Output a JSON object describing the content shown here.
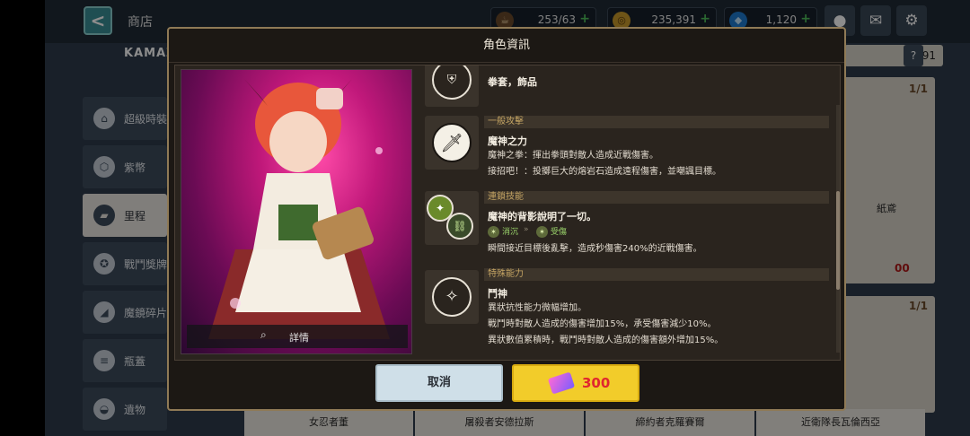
{
  "topbar": {
    "back_label": "<",
    "title": "商店",
    "stamina": "253/63",
    "gold": "235,391",
    "gems": "1,120",
    "chat_icon": "speech-bubble-icon",
    "mail_icon": "envelope-icon",
    "settings_icon": "gear-icon"
  },
  "sidebar": {
    "brand": "KAMAZ",
    "items": [
      {
        "label": "超級時裝",
        "icon": "hanger-icon"
      },
      {
        "label": "紫幣",
        "icon": "hexagon-coin-icon"
      },
      {
        "label": "里程",
        "icon": "ticket-icon"
      },
      {
        "label": "戰鬥獎牌",
        "icon": "medal-icon"
      },
      {
        "label": "魔鏡碎片",
        "icon": "mirror-shard-icon"
      },
      {
        "label": "瓶蓋",
        "icon": "bottle-cap-icon"
      },
      {
        "label": "遺物",
        "icon": "relic-icon"
      }
    ]
  },
  "background": {
    "search_value": "91",
    "help_label": "?",
    "cards": [
      {
        "count": "1/1",
        "name": "紙鳶",
        "price": "00"
      },
      {
        "count": "1/1"
      }
    ],
    "bottom_names": [
      "女忍者董",
      "屠殺者安德拉斯",
      "締約者克羅賽爾",
      "近衛隊長瓦倫西亞"
    ]
  },
  "modal": {
    "title": "角色資訊",
    "detail_label": "詳情",
    "equip_text": "拳套，飾品",
    "skills": [
      {
        "category": "一般攻擊",
        "name": "魔神之力",
        "lines": [
          "魔神之拳：揮出拳頭對敵人造成近戰傷害。",
          "接招吧！：投擲巨大的熔岩石造成遠程傷害，並嘲諷目標。"
        ],
        "icon": "sword-icon"
      },
      {
        "category": "連鎖技能",
        "name": "魔神的背影說明了一切。",
        "tag_from": "消沉",
        "tag_arrow": "»",
        "tag_to": "受傷",
        "lines": [
          "瞬間接近目標後亂擊，造成秒傷害240%的近戰傷害。"
        ],
        "icon": "chain-icon"
      },
      {
        "category": "特殊能力",
        "name": "鬥神",
        "lines": [
          "異狀抗性能力微幅增加。",
          "戰鬥時對敵人造成的傷害增加15%，承受傷害減少10%。",
          "異狀數值累積時，戰鬥時對敵人造成的傷害額外增加15%。"
        ],
        "icon": "sparkle-icon"
      }
    ],
    "cancel_label": "取消",
    "buy_price": "300",
    "buy_icon": "mileage-ticket-icon"
  }
}
